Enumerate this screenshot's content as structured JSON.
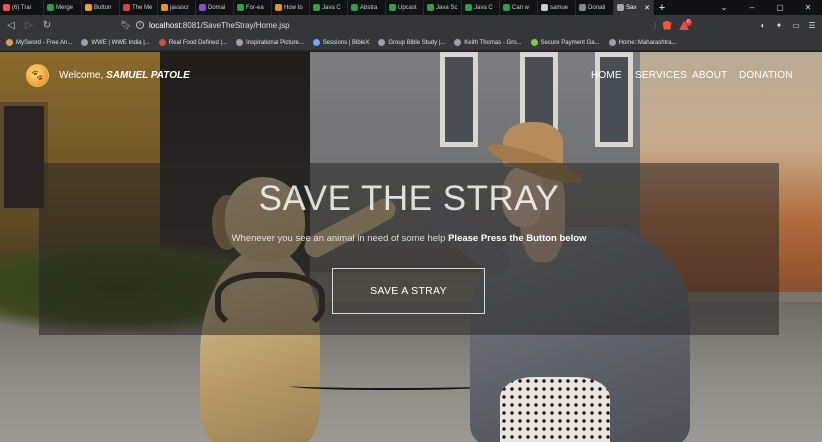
{
  "browser": {
    "tabs": [
      {
        "label": "(6) Trai",
        "color": "#ff4d4d"
      },
      {
        "label": "Merge",
        "color": "#2ea043"
      },
      {
        "label": "Button",
        "color": "#f0a030"
      },
      {
        "label": "The Me",
        "color": "#e04040"
      },
      {
        "label": "javascr",
        "color": "#f28c28"
      },
      {
        "label": "Domai",
        "color": "#7f4fd8"
      },
      {
        "label": "For-ea",
        "color": "#2ea043"
      },
      {
        "label": "How to",
        "color": "#f28c28"
      },
      {
        "label": "Java C",
        "color": "#2ea043"
      },
      {
        "label": "Abstra",
        "color": "#2ea043"
      },
      {
        "label": "Upcast",
        "color": "#2ea043"
      },
      {
        "label": "Java Sc",
        "color": "#2ea043"
      },
      {
        "label": "Java C",
        "color": "#2ea043"
      },
      {
        "label": "Can w",
        "color": "#2ea043"
      },
      {
        "label": "samue",
        "color": "#cccccc"
      },
      {
        "label": "Donati",
        "color": "#888888"
      },
      {
        "label": "Sav",
        "color": "#aaaaaa",
        "active": true
      }
    ],
    "url_host": "localhost",
    "url_rest": ":8081/SaveTheStray/Home.jsp",
    "shields_count": "0",
    "bookmarks": [
      {
        "label": "MySword - Free An...",
        "color": "#cfa54a"
      },
      {
        "label": "WWE | WWE India |...",
        "color": "#9aa0a6"
      },
      {
        "label": "Real Food Defined |...",
        "color": "#d94a3b"
      },
      {
        "label": "Inspirational Picture...",
        "color": "#9aa0a6"
      },
      {
        "label": "Sessions | BibleX",
        "color": "#6aa9ff"
      },
      {
        "label": "Group Bible Study |...",
        "color": "#9aa0a6"
      },
      {
        "label": "Keith Thomas - Gro...",
        "color": "#9aa0a6"
      },
      {
        "label": "Secure Payment Ga...",
        "color": "#8bc34a"
      },
      {
        "label": "Home::Maharashtra...",
        "color": "#9aa0a6"
      }
    ]
  },
  "site": {
    "welcome_prefix": "Welcome,",
    "user_name": "SAMUEL PATOLE",
    "nav": [
      "HOME",
      "SERVICES",
      "ABOUT",
      "DONATION"
    ],
    "hero": {
      "title": "SAVE THE STRAY",
      "subtitle_plain": "Whenever you see an animal in need of some help",
      "subtitle_bold": "Please Press the Button below",
      "button_label": "SAVE A STRAY"
    }
  }
}
